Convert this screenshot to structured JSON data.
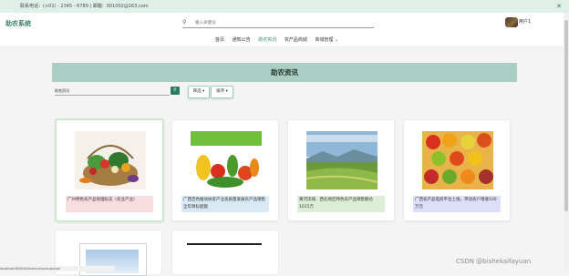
{
  "topbar": {
    "contact": "联系电话：(+01) - 2345 - 6789 | 邮箱：001002@163.com",
    "close": "✕"
  },
  "header": {
    "brand": "助农系统",
    "search_placeholder": "输入关键词",
    "user_name": "用户1",
    "nav": [
      "首页",
      "通知公告",
      "助农资讯",
      "农产品商城",
      "商城管理"
    ],
    "nav_active": "助农资讯"
  },
  "main": {
    "title": "助农资讯",
    "search_value": "助农资讯",
    "filter_label": "筛选",
    "sort_label": "排序"
  },
  "articles": [
    {
      "caption": "广州特色农产品地理标志（农业产业）",
      "caption_bg": "#f7dde0"
    },
    {
      "caption": "广西百色推动扶贫产业高质量发展农产品销售全年目标超额",
      "caption_bg": "#d9e9f3"
    },
    {
      "caption": "黄河流域、西北地区特色农产品销售额达1015万",
      "caption_bg": "#dcefd6"
    },
    {
      "caption": "广西农产品电商平台上线，带动农户增收100万元",
      "caption_bg": "#dcdff7"
    }
  ],
  "statusbar": "localhost:8080/#/index/zhunongzixun",
  "watermark": "CSDN @bishekaifayuan"
}
